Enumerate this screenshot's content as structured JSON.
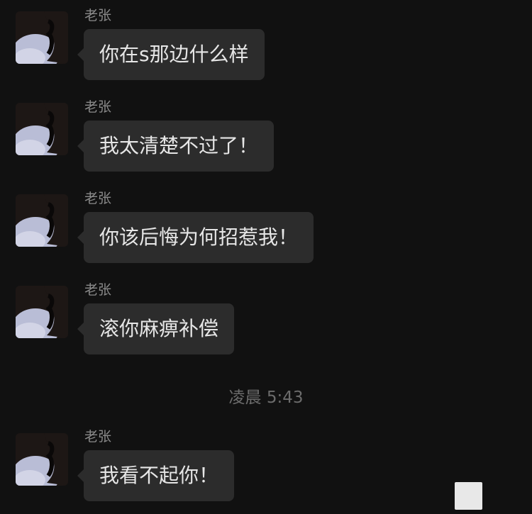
{
  "chat": {
    "messages": [
      {
        "sender": "老张",
        "text": "你在s那边什么样"
      },
      {
        "sender": "老张",
        "text": "我太清楚不过了！"
      },
      {
        "sender": "老张",
        "text": "你该后悔为何招惹我！"
      },
      {
        "sender": "老张",
        "text": "滚你麻痹补偿"
      },
      {
        "sender": "老张",
        "text": "我看不起你！"
      }
    ],
    "timestamp": "凌晨 5:43"
  },
  "colors": {
    "background": "#111111",
    "bubble": "#2c2c2c",
    "text": "#e6e6e6",
    "sender": "#8a8a8a",
    "timestamp": "#6c6c6c"
  }
}
